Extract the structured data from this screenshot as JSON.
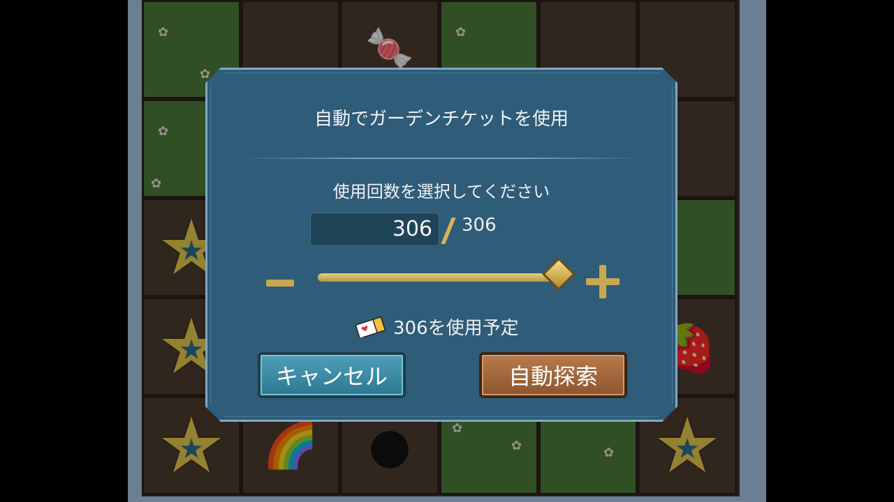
{
  "dialog": {
    "title": "自動でガーデンチケットを使用",
    "prompt": "使用回数を選択してください",
    "count": {
      "value": "306",
      "max": "306"
    },
    "slider": {
      "value": 306,
      "min": 0,
      "max": 306
    },
    "plan_text": "306を使用予定",
    "buttons": {
      "cancel": "キャンセル",
      "auto": "自動探索"
    },
    "icons": {
      "minus": "minus-icon",
      "plus": "plus-icon",
      "ticket": "ticket-icon"
    }
  },
  "colors": {
    "dialog_bg": "#2f5c78",
    "accent_gold": "#c9a750",
    "cancel": "#3b8aa5",
    "auto": "#a06a3e"
  }
}
